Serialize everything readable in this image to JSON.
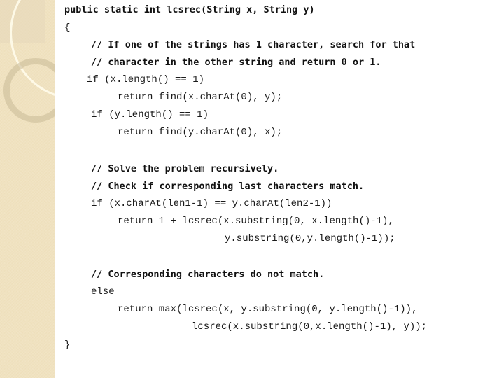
{
  "slide": {
    "code_lines": [
      "public static int lcsrec(String x, String y)",
      "{",
      "// If one of the strings has 1 character, search for that",
      "// character in the other string and return 0 or 1.",
      "if (x.length() == 1)",
      "return find(x.charAt(0), y);",
      "if (y.length() == 1)",
      "return find(y.charAt(0), x);",
      "// Solve the problem recursively.",
      "// Check if corresponding last characters match.",
      "if (x.charAt(len1-1) == y.charAt(len2-1))",
      "return 1 + lcsrec(x.substring(0, x.length()-1),",
      "y.substring(0,y.length()-1));",
      "// Corresponding characters do not match.",
      "else",
      "return max(lcsrec(x, y.substring(0, y.length()-1)),",
      "lcsrec(x.substring(0,x.length()-1), y));",
      "}"
    ]
  }
}
